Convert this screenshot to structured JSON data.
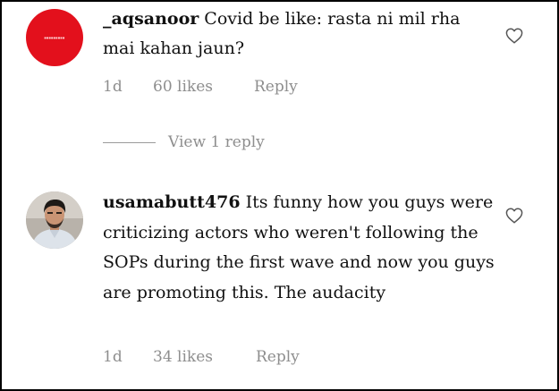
{
  "comments": [
    {
      "username": "_aqsanoor",
      "text": "Covid be like: rasta ni mil rha mai kahan jaun?",
      "time": "1d",
      "likes": "60 likes",
      "reply": "Reply",
      "view_replies": "View 1 reply",
      "avatar": {
        "type": "logo",
        "color": "#e3101c"
      }
    },
    {
      "username": "usamabutt476",
      "text": "Its funny how you guys were criticizing actors who weren't following the SOPs during the first wave and now you guys are promoting this. The audacity",
      "time": "1d",
      "likes": "34 likes",
      "reply": "Reply",
      "avatar": {
        "type": "photo"
      }
    }
  ],
  "icons": {
    "like": "heart-outline-icon"
  }
}
